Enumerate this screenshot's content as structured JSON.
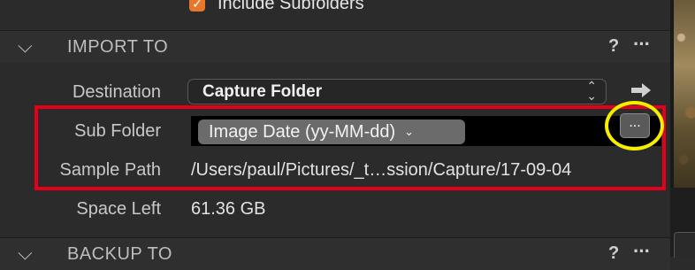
{
  "top": {
    "checkbox_label": "Include Subfolders",
    "checkbox_checked": true,
    "accent_color": "#e8762b"
  },
  "import_to": {
    "title": "IMPORT TO",
    "help": "?",
    "more": "···",
    "destination": {
      "label": "Destination",
      "value": "Capture Folder"
    },
    "sub_folder": {
      "label": "Sub Folder",
      "token": "Image Date (yy-MM-dd)",
      "button": "..."
    },
    "sample_path": {
      "label": "Sample Path",
      "value": "/Users/paul/Pictures/_t…ssion/Capture/17-09-04"
    },
    "space_left": {
      "label": "Space Left",
      "value": "61.36 GB"
    }
  },
  "backup_to": {
    "title": "BACKUP TO",
    "help": "?",
    "more": "···"
  },
  "annotations": {
    "highlight_box_color": "#e2001a",
    "highlight_circle_color": "#f5ee00"
  }
}
